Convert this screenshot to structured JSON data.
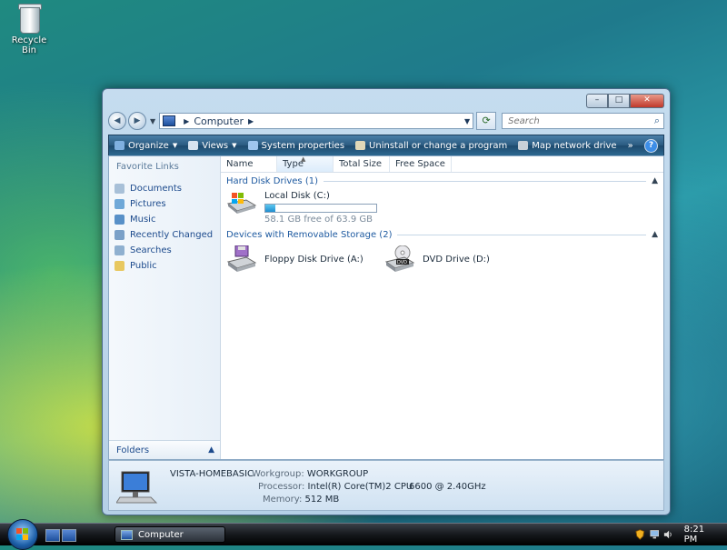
{
  "desktop": {
    "recycle_bin_label": "Recycle Bin"
  },
  "window": {
    "caption_buttons": {
      "minimize": "–",
      "maximize": "□",
      "close": "✕"
    },
    "address": {
      "location": "Computer",
      "search_placeholder": "Search"
    },
    "toolbar": {
      "organize": "Organize",
      "views": "Views",
      "system_properties": "System properties",
      "uninstall": "Uninstall or change a program",
      "map_drive": "Map network drive",
      "more": "»",
      "help": "?"
    },
    "nav_pane": {
      "title": "Favorite Links",
      "links": [
        {
          "label": "Documents"
        },
        {
          "label": "Pictures"
        },
        {
          "label": "Music"
        },
        {
          "label": "Recently Changed"
        },
        {
          "label": "Searches"
        },
        {
          "label": "Public"
        }
      ],
      "folders_label": "Folders"
    },
    "columns": [
      "Name",
      "Type",
      "Total Size",
      "Free Space"
    ],
    "groups": {
      "hard_disks": {
        "header": "Hard Disk Drives (1)",
        "drives": [
          {
            "name": "Local Disk (C:)",
            "free_text": "58.1 GB free of 63.9 GB",
            "used_fraction": 0.09
          }
        ]
      },
      "removable": {
        "header": "Devices with Removable Storage (2)",
        "drives": [
          {
            "name": "Floppy Disk Drive (A:)"
          },
          {
            "name": "DVD Drive (D:)",
            "icon_label": "DVD"
          }
        ]
      }
    },
    "details": {
      "computer_name": "VISTA-HOMEBASIC",
      "workgroup_label": "Workgroup:",
      "workgroup": "WORKGROUP",
      "processor_label": "Processor:",
      "processor": "Intel(R) Core(TM)2 CPU",
      "processor_speed": "6600  @ 2.40GHz",
      "memory_label": "Memory:",
      "memory": "512 MB"
    }
  },
  "taskbar": {
    "task_label": "Computer",
    "clock": "8:21 PM"
  }
}
